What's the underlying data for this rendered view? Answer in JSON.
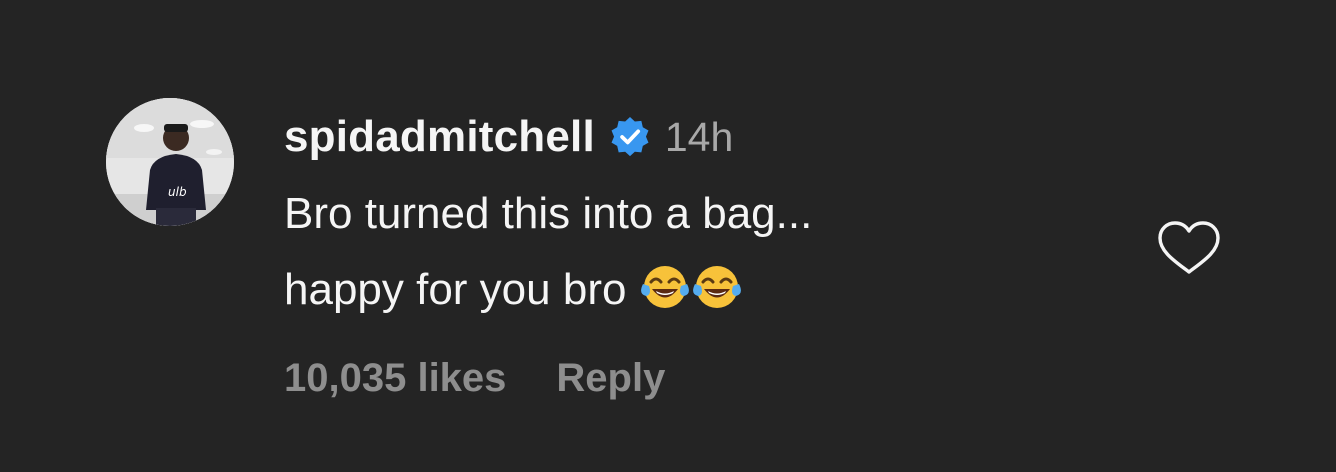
{
  "comment": {
    "username": "spidadmitchell",
    "verified_icon": "verified-badge-icon",
    "timestamp": "14h",
    "text_line_1": "Bro turned this into a bag...",
    "text_line_2": "happy for you bro",
    "emojis": [
      "face-with-tears-of-joy-icon",
      "face-with-tears-of-joy-icon"
    ],
    "likes": "10,035 likes",
    "reply_label": "Reply",
    "like_icon": "heart-outline-icon"
  },
  "colors": {
    "background": "#242424",
    "primary_text": "#f5f5f5",
    "secondary_text": "#8e8e8e",
    "verified_blue": "#3897f0"
  }
}
